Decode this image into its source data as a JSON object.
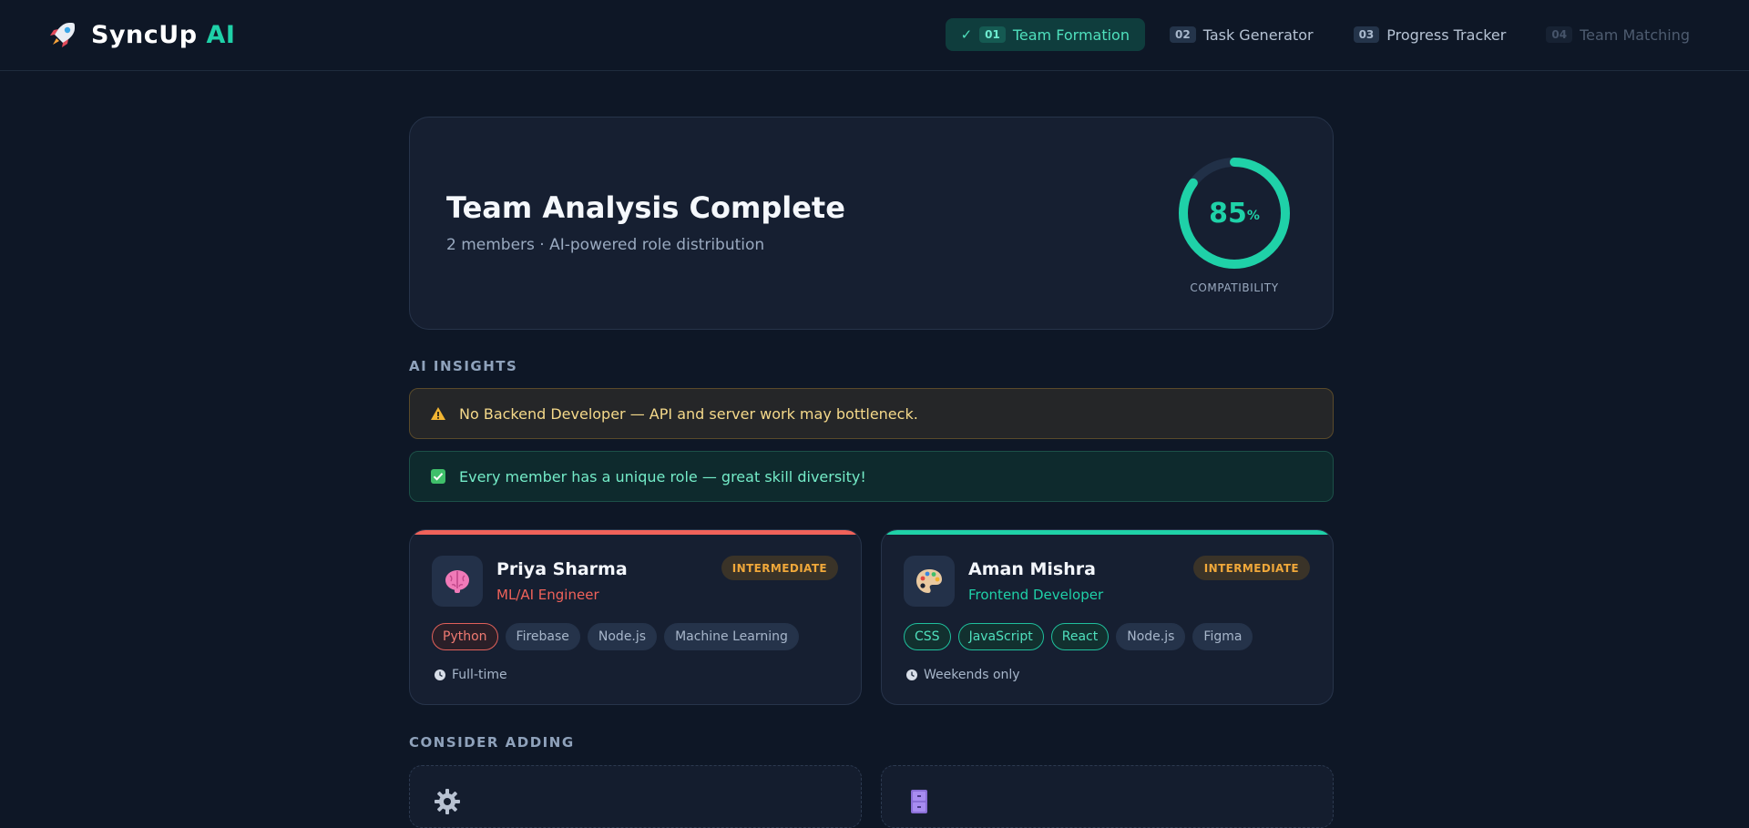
{
  "app": {
    "name": "SyncUp",
    "accent": "AI"
  },
  "steps": [
    {
      "num": "01",
      "label": "Team Formation",
      "state": "done"
    },
    {
      "num": "02",
      "label": "Task Generator",
      "state": "normal"
    },
    {
      "num": "03",
      "label": "Progress Tracker",
      "state": "normal"
    },
    {
      "num": "04",
      "label": "Team Matching",
      "state": "disabled"
    }
  ],
  "summary": {
    "title": "Team Analysis Complete",
    "subtitle": "2 members · AI-powered role distribution",
    "compatibility_value": "85",
    "compatibility_unit": "%",
    "compatibility_fraction": 0.85,
    "compatibility_label": "COMPATIBILITY"
  },
  "insights": {
    "heading": "AI INSIGHTS",
    "warning": "No Backend Developer — API and server work may bottleneck.",
    "success": "Every member has a unique role — great skill diversity!"
  },
  "members": [
    {
      "name": "Priya Sharma",
      "role": "ML/AI Engineer",
      "level": "INTERMEDIATE",
      "avatar_icon": "brain-icon",
      "accent_color": "#f0625a",
      "skills": [
        {
          "label": "Python",
          "highlight": true
        },
        {
          "label": "Firebase",
          "highlight": false
        },
        {
          "label": "Node.js",
          "highlight": false
        },
        {
          "label": "Machine Learning",
          "highlight": false
        }
      ],
      "availability": "Full-time"
    },
    {
      "name": "Aman Mishra",
      "role": "Frontend Developer",
      "level": "INTERMEDIATE",
      "avatar_icon": "palette-icon",
      "accent_color": "#1fd1a8",
      "skills": [
        {
          "label": "CSS",
          "highlight": true
        },
        {
          "label": "JavaScript",
          "highlight": true
        },
        {
          "label": "React",
          "highlight": true
        },
        {
          "label": "Node.js",
          "highlight": false
        },
        {
          "label": "Figma",
          "highlight": false
        }
      ],
      "availability": "Weekends only"
    }
  ],
  "consider": {
    "heading": "CONSIDER ADDING",
    "items": [
      {
        "icon": "gear-icon"
      },
      {
        "icon": "file-cabinet-icon"
      }
    ]
  },
  "colors": {
    "background": "#0e1726",
    "accent_teal": "#1fd1a8",
    "warning": "#f5d98a",
    "level_badge": "#f0a83a"
  }
}
